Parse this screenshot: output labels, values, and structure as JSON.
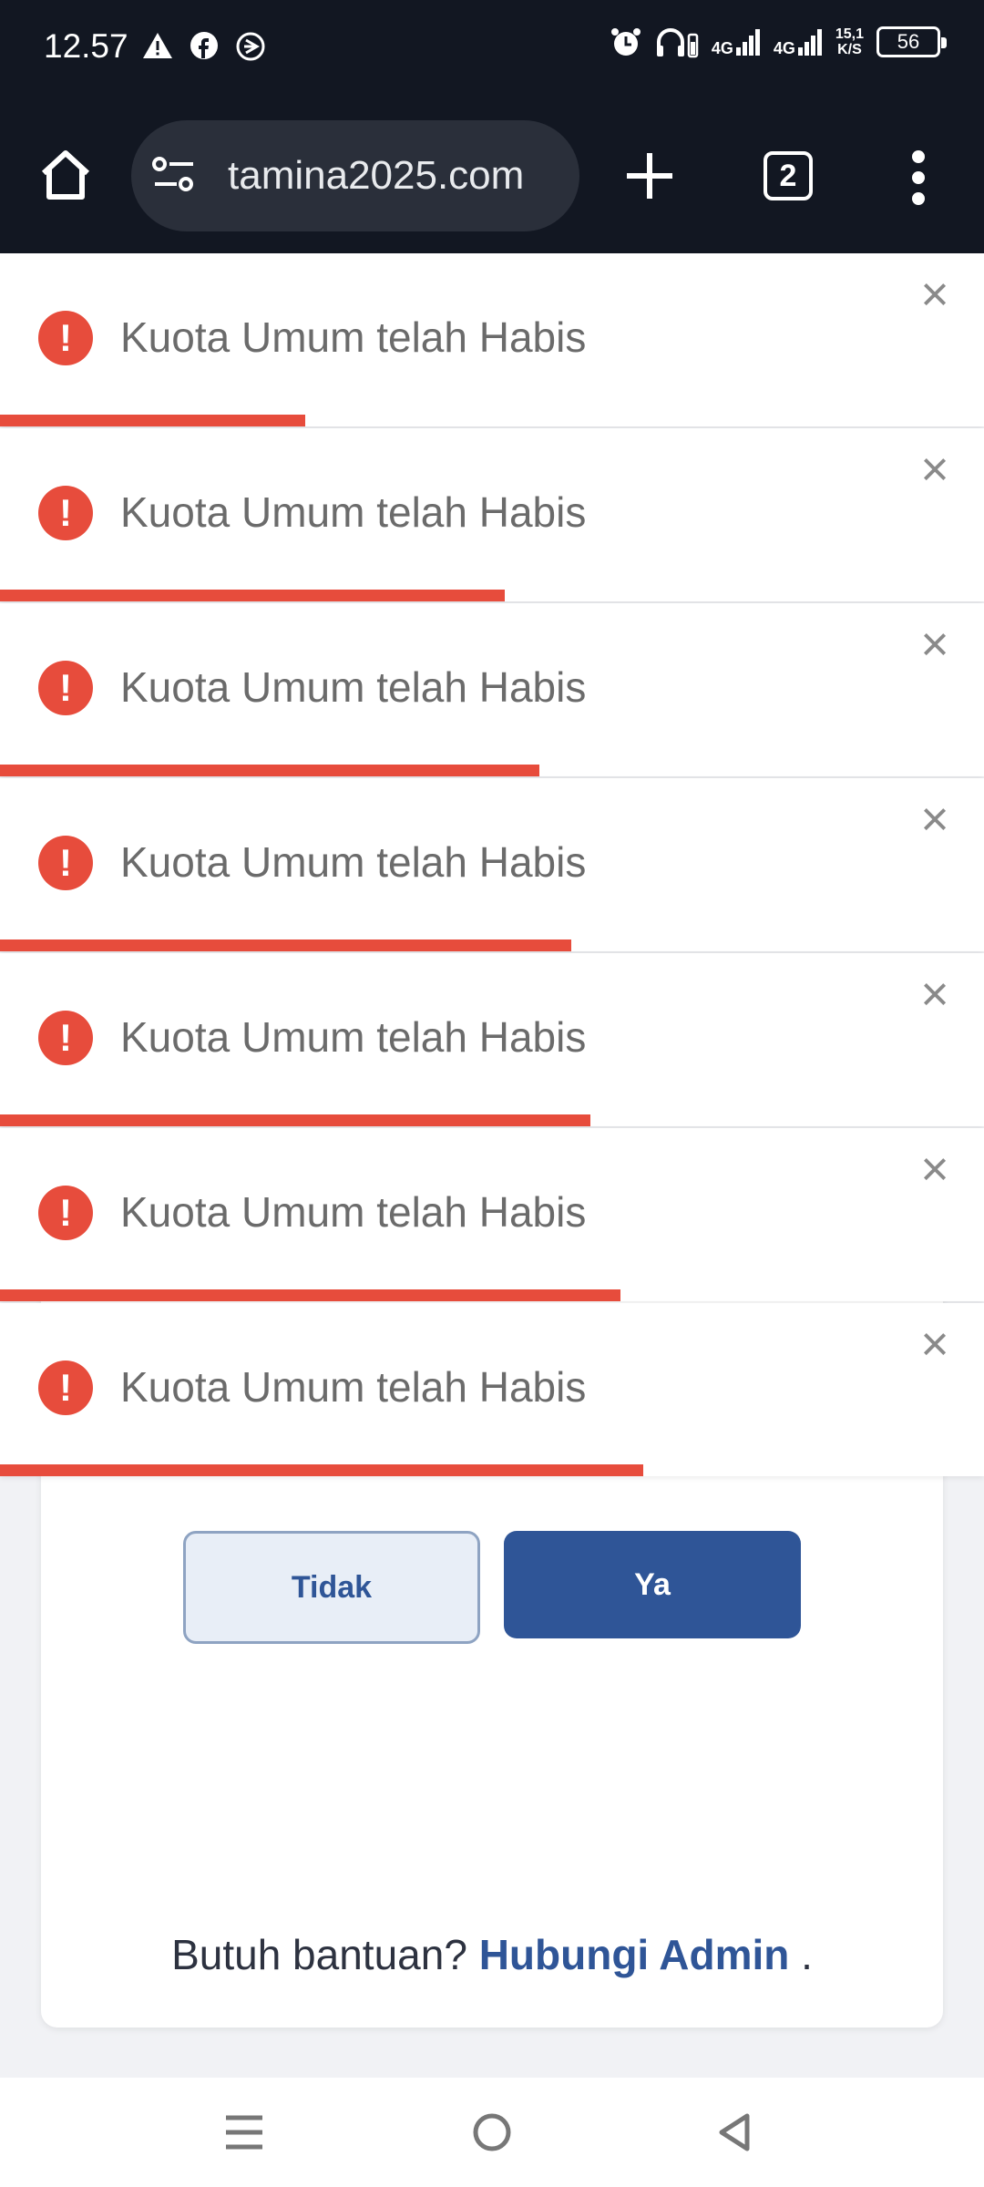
{
  "status_bar": {
    "time": "12.57",
    "network_1": "4G",
    "network_2": "4G",
    "speed_value": "15,1",
    "speed_unit": "K/S",
    "battery": "56"
  },
  "browser": {
    "url": "tamina2025.com",
    "tab_count": "2"
  },
  "toasts": [
    {
      "message": "Kuota Umum telah Habis",
      "progress": 0.31
    },
    {
      "message": "Kuota Umum telah Habis",
      "progress": 0.513
    },
    {
      "message": "Kuota Umum telah Habis",
      "progress": 0.548
    },
    {
      "message": "Kuota Umum telah Habis",
      "progress": 0.581
    },
    {
      "message": "Kuota Umum telah Habis",
      "progress": 0.6
    },
    {
      "message": "Kuota Umum telah Habis",
      "progress": 0.631
    },
    {
      "message": "Kuota Umum telah Habis",
      "progress": 0.654
    }
  ],
  "toast_icon_glyph": "!",
  "toast_close_glyph": "×",
  "dialog": {
    "no_label": "Tidak",
    "yes_label": "Ya"
  },
  "help": {
    "prefix": "Butuh bantuan?",
    "link": "Hubungi Admin",
    "suffix": "."
  },
  "colors": {
    "error": "#e74c3c",
    "primary": "#2f5597",
    "toolbar": "#121722"
  }
}
